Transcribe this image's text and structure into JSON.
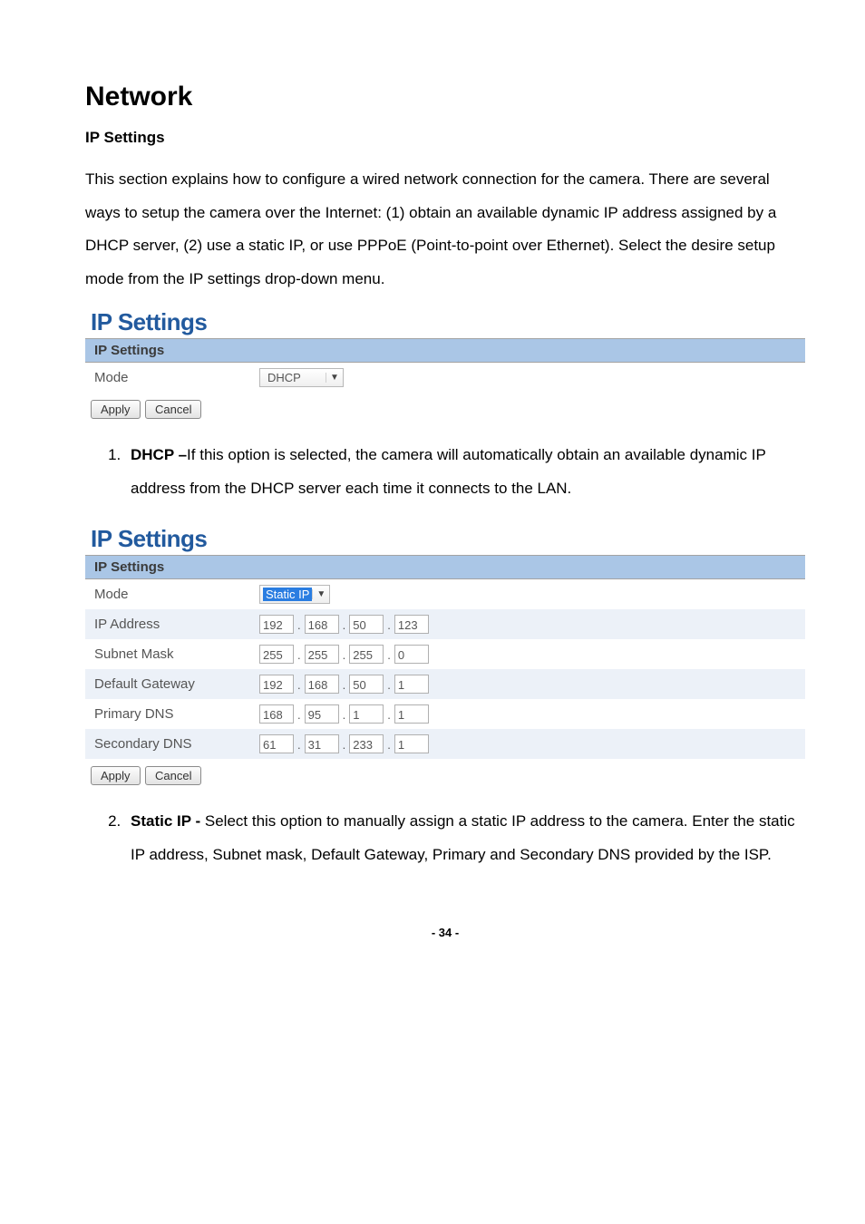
{
  "page": {
    "title": "Network",
    "subheading": "IP Settings",
    "intro": "This section explains how to configure a wired network connection for the camera. There are several ways to setup the camera over the Internet: (1) obtain an available dynamic IP address assigned by a DHCP server, (2) use a static IP, or use PPPoE (Point-to-point over Ethernet). Select the desire setup mode from the IP settings drop-down menu.",
    "footer": "- 34 -"
  },
  "panel1": {
    "title": "IP Settings",
    "header": "IP Settings",
    "mode_label": "Mode",
    "mode_value": "DHCP",
    "apply": "Apply",
    "cancel": "Cancel"
  },
  "list1": {
    "num": "1.",
    "bold": "DHCP –",
    "text": "If this option is selected, the camera will automatically obtain an available dynamic IP address from the DHCP server each time it connects to the LAN."
  },
  "panel2": {
    "title": "IP Settings",
    "header": "IP Settings",
    "mode_label": "Mode",
    "mode_value": "Static IP",
    "rows": [
      {
        "label": "IP Address",
        "o": [
          "192",
          "168",
          "50",
          "123"
        ]
      },
      {
        "label": "Subnet Mask",
        "o": [
          "255",
          "255",
          "255",
          "0"
        ]
      },
      {
        "label": "Default Gateway",
        "o": [
          "192",
          "168",
          "50",
          "1"
        ]
      },
      {
        "label": "Primary DNS",
        "o": [
          "168",
          "95",
          "1",
          "1"
        ]
      },
      {
        "label": "Secondary DNS",
        "o": [
          "61",
          "31",
          "233",
          "1"
        ]
      }
    ],
    "apply": "Apply",
    "cancel": "Cancel"
  },
  "list2": {
    "num": "2.",
    "bold": "Static IP -",
    "text": " Select this option to manually assign a static IP address to the camera. Enter the static IP address, Subnet mask, Default Gateway, Primary and Secondary DNS provided by the ISP."
  }
}
